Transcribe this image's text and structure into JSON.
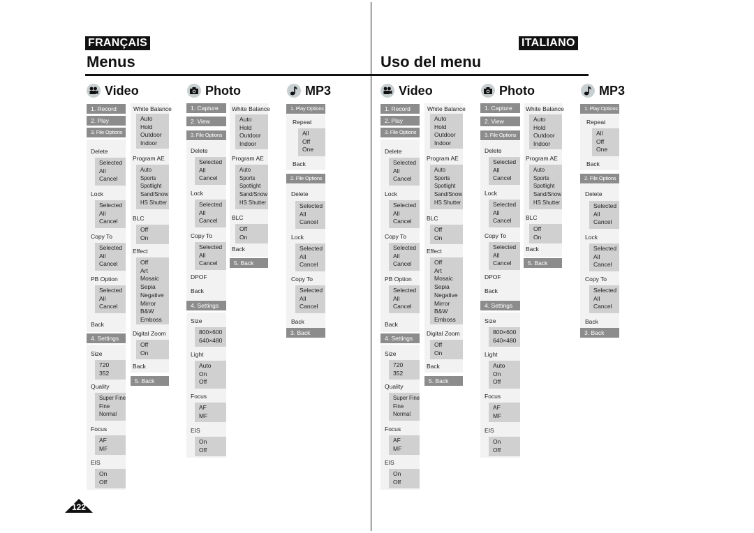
{
  "page_number": "122",
  "panels": [
    {
      "language": "FRANÇAIS",
      "title": "Menus",
      "sections": {
        "video": "Video",
        "photo": "Photo",
        "mp3": "MP3"
      }
    },
    {
      "language": "ITALIANO",
      "title": "Uso del menu",
      "sections": {
        "video": "Video",
        "photo": "Photo",
        "mp3": "MP3"
      }
    }
  ],
  "video": {
    "record": "1. Record",
    "play": "2. Play",
    "file_options": "3. File Options",
    "delete": "Delete",
    "delete_opts": [
      "Selected",
      "All",
      "Cancel"
    ],
    "lock": "Lock",
    "lock_opts": [
      "Selected",
      "All",
      "Cancel"
    ],
    "copy_to": "Copy To",
    "copy_opts": [
      "Selected",
      "All",
      "Cancel"
    ],
    "pb_option": "PB Option",
    "pb_opts": [
      "Selected",
      "All",
      "Cancel"
    ],
    "back": "Back",
    "settings": "4. Settings",
    "size": "Size",
    "size_opts": [
      "720",
      "352"
    ],
    "quality": "Quality",
    "quality_opts": [
      "Super Fine",
      "Fine",
      "Normal"
    ],
    "focus": "Focus",
    "focus_opts": [
      "AF",
      "MF"
    ],
    "eis": "EIS",
    "eis_opts": [
      "On",
      "Off"
    ],
    "white_balance": "White Balance",
    "wb_opts": [
      "Auto",
      "Hold",
      "Outdoor",
      "Indoor"
    ],
    "program_ae": "Program AE",
    "ae_opts": [
      "Auto",
      "Sports",
      "Spotlight",
      "Sand/Snow",
      "HS Shutter"
    ],
    "blc": "BLC",
    "blc_opts": [
      "Off",
      "On"
    ],
    "effect": "Effect",
    "effect_opts": [
      "Off",
      "Art",
      "Mosaic",
      "Sepia",
      "Negative",
      "Mirror",
      "B&W",
      "Emboss"
    ],
    "digital_zoom": "Digital Zoom",
    "dz_opts": [
      "Off",
      "On"
    ],
    "back2": "Back",
    "back5": "5. Back"
  },
  "photo": {
    "capture": "1. Capture",
    "view": "2. View",
    "file_options": "3. File Options",
    "delete": "Delete",
    "delete_opts": [
      "Selected",
      "All",
      "Cancel"
    ],
    "lock": "Lock",
    "lock_opts": [
      "Selected",
      "All",
      "Cancel"
    ],
    "copy_to": "Copy To",
    "copy_opts": [
      "Selected",
      "All",
      "Cancel"
    ],
    "dpof": "DPOF",
    "back": "Back",
    "settings": "4. Settings",
    "size": "Size",
    "size_opts": [
      "800×600",
      "640×480"
    ],
    "light": "Light",
    "light_opts": [
      "Auto",
      "On",
      "Off"
    ],
    "focus": "Focus",
    "focus_opts": [
      "AF",
      "MF"
    ],
    "eis": "EIS",
    "eis_opts": [
      "On",
      "Off"
    ],
    "white_balance": "White Balance",
    "wb_opts": [
      "Auto",
      "Hold",
      "Outdoor",
      "Indoor"
    ],
    "program_ae": "Program AE",
    "ae_opts": [
      "Auto",
      "Sports",
      "Spotlight",
      "Sand/Snow",
      "HS Shutter"
    ],
    "blc": "BLC",
    "blc_opts": [
      "Off",
      "On"
    ],
    "back2": "Back",
    "back5": "5. Back"
  },
  "mp3": {
    "play_options": "1. Play Options",
    "repeat": "Repeat",
    "repeat_opts": [
      "All",
      "Off",
      "One"
    ],
    "back": "Back",
    "file_options": "2. File Options",
    "delete": "Delete",
    "delete_opts": [
      "Selected",
      "All",
      "Cancel"
    ],
    "lock": "Lock",
    "lock_opts": [
      "Selected",
      "All",
      "Cancel"
    ],
    "copy_to": "Copy To",
    "copy_opts": [
      "Selected",
      "All",
      "Cancel"
    ],
    "back2": "Back",
    "back3": "3. Back"
  }
}
